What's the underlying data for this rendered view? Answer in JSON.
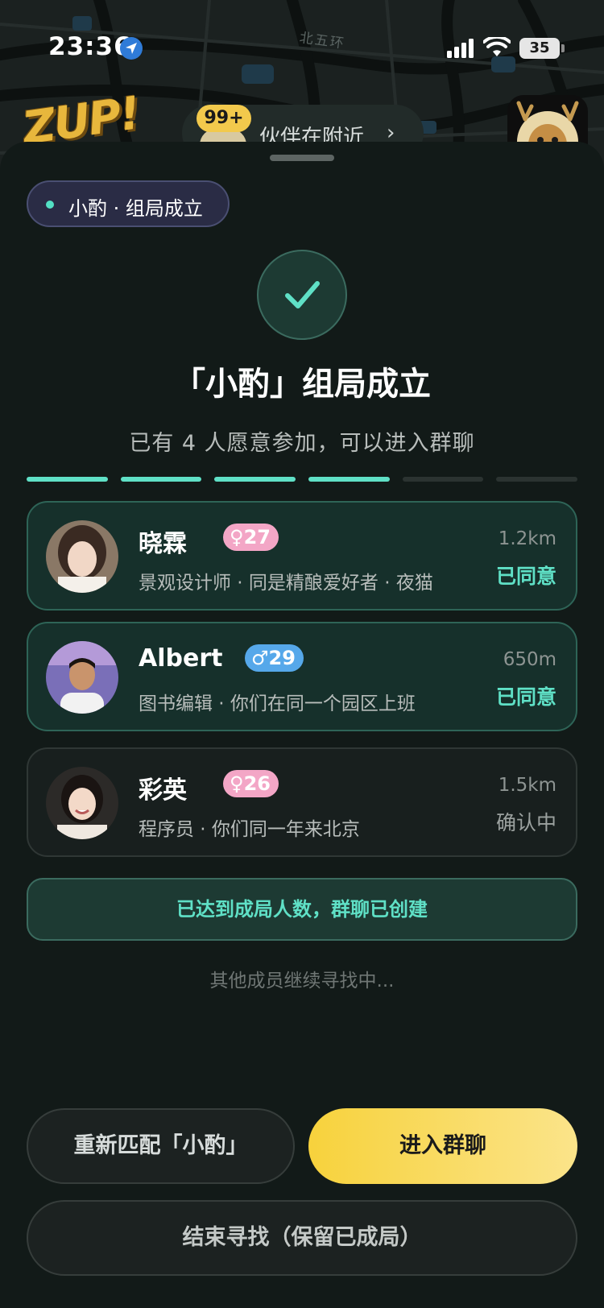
{
  "status_bar": {
    "time": "23:36",
    "battery": "35"
  },
  "map": {
    "road_label": "北五环",
    "logo_text": "ZUP!",
    "nearby_badge": "99+",
    "nearby_label": "伙伴在附近"
  },
  "sheet": {
    "tag": "小酌 · 组局成立",
    "headline": "「小酌」组局成立",
    "subtitle": "已有 4 人愿意参加，可以进入群聊",
    "progress": {
      "total_segments": 6,
      "filled_segments": 4
    },
    "members": [
      {
        "name": "晓霖",
        "gender": "female",
        "gender_symbol": "♀",
        "age": "27",
        "description": "景观设计师 · 同是精酿爱好者 · 夜猫",
        "distance": "1.2km",
        "status": "已同意",
        "status_kind": "agreed"
      },
      {
        "name": "Albert",
        "gender": "male",
        "gender_symbol": "♂",
        "age": "29",
        "description": "图书编辑 ·  你们在同一个园区上班",
        "distance": "650m",
        "status": "已同意",
        "status_kind": "agreed"
      },
      {
        "name": "彩英",
        "gender": "female",
        "gender_symbol": "♀",
        "age": "26",
        "description": "程序员 · 你们同一年来北京",
        "distance": "1.5km",
        "status": "确认中",
        "status_kind": "pending"
      }
    ],
    "notice": "已达到成局人数，群聊已创建",
    "searching": "其他成员继续寻找中...",
    "buttons": {
      "rematch": "重新匹配「小酌」",
      "enter_chat": "进入群聊",
      "end_search": "结束寻找（保留已成局）"
    }
  },
  "colors": {
    "accent": "#5fe0c6",
    "primary_button": "#f7d23c",
    "female_badge": "#f3a6c6",
    "male_badge": "#56a8ea"
  }
}
